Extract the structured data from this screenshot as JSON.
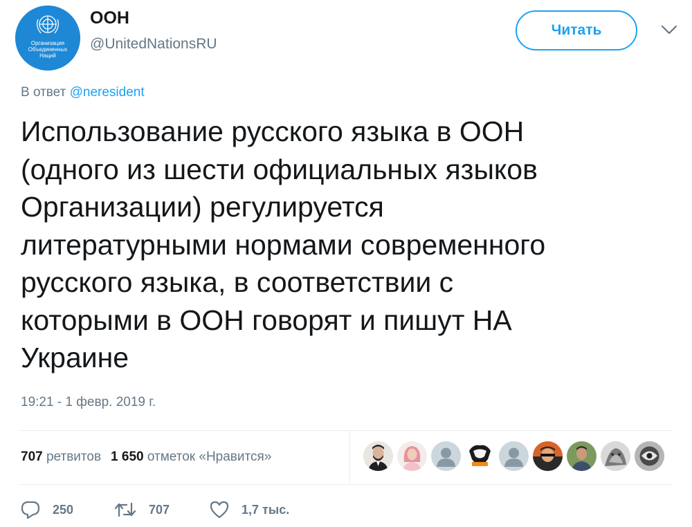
{
  "account": {
    "avatar_text": [
      "Организация",
      "Объединенных",
      "Наций"
    ],
    "display_name": "ООН",
    "handle": "@UnitedNationsRU",
    "follow_label": "Читать"
  },
  "tweet": {
    "reply_prefix": "В ответ",
    "reply_to": "@neresident",
    "text": "Использование русского языка в ООН\n(одного из шести официальных языков\nОрганизации) регулируется\nлитературными нормами современного\nрусского языка, в соответствии с\nкоторыми в ООН говорят и пишут НА\nУкраине",
    "timestamp": "19:21 - 1 февр. 2019 г."
  },
  "stats": {
    "retweets_count": "707",
    "retweets_label": "ретвитов",
    "likes_count": "1 650",
    "likes_label": "отметок «Нравится»"
  },
  "likers": [
    {
      "icon": "liker-avatar-man-beard"
    },
    {
      "icon": "liker-avatar-woman-pink-hair"
    },
    {
      "icon": "default-profile-icon"
    },
    {
      "icon": "virtus-pro-logo-icon"
    },
    {
      "icon": "default-profile-icon"
    },
    {
      "icon": "liker-avatar-photo"
    },
    {
      "icon": "liker-avatar-photo"
    },
    {
      "icon": "liker-avatar-photo"
    },
    {
      "icon": "liker-avatar-photo"
    }
  ],
  "actions": {
    "replies": "250",
    "retweets": "707",
    "likes": "1,7 тыс."
  },
  "colors": {
    "accent": "#1da1f2",
    "text": "#14171a",
    "muted": "#657786",
    "avatar_bg": "#1e88d6"
  }
}
